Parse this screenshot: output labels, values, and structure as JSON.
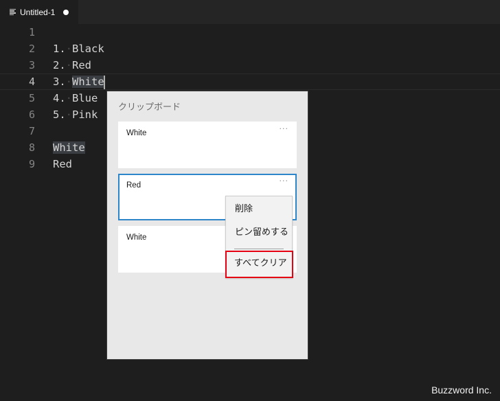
{
  "tab": {
    "icon": "file-lines-icon",
    "title": "Untitled-1",
    "dirty_indicator": "unsaved-dot-icon"
  },
  "editor": {
    "current_line": 4,
    "lines": [
      {
        "number": "1",
        "text": ""
      },
      {
        "number": "2",
        "prefix": "1.",
        "text": "Black"
      },
      {
        "number": "3",
        "prefix": "2.",
        "text": "Red"
      },
      {
        "number": "4",
        "prefix": "3.",
        "text": "White"
      },
      {
        "number": "5",
        "prefix": "4.",
        "text": "Blue"
      },
      {
        "number": "6",
        "prefix": "5.",
        "text": "Pink"
      },
      {
        "number": "7",
        "text": ""
      },
      {
        "number": "8",
        "text": "White"
      },
      {
        "number": "9",
        "text": "Red"
      }
    ]
  },
  "clipboard": {
    "title": "クリップボード",
    "items": [
      {
        "text": "White",
        "more": "···",
        "selected": false
      },
      {
        "text": "Red",
        "more": "···",
        "selected": true
      },
      {
        "text": "White",
        "more": "···",
        "selected": false
      }
    ]
  },
  "context_menu": {
    "items": [
      {
        "label": "削除"
      },
      {
        "label": "ピン留めする"
      },
      {
        "label": "すべてクリア",
        "highlighted": true
      }
    ],
    "highlight_color": "#e50012"
  },
  "watermark": "Buzzword Inc."
}
